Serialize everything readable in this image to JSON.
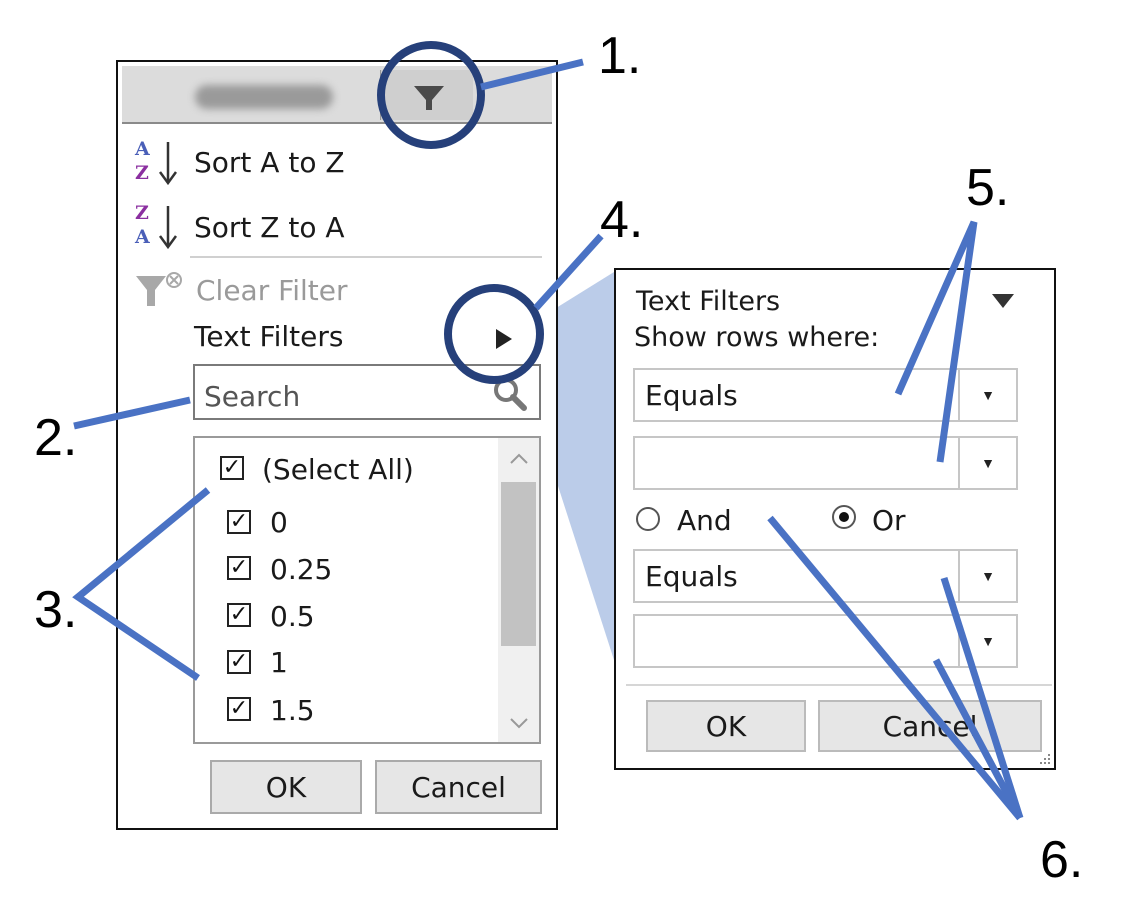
{
  "left_panel": {
    "menu": {
      "sort_az": "Sort A to Z",
      "sort_za": "Sort Z to A",
      "clear_filter": "Clear Filter",
      "text_filters": "Text Filters"
    },
    "sort_az_icon": {
      "top": "A",
      "bottom": "Z"
    },
    "sort_za_icon": {
      "top": "Z",
      "bottom": "A"
    },
    "search": {
      "placeholder": "Search"
    },
    "list": [
      {
        "label": "(Select All)",
        "checked": true
      },
      {
        "label": "0",
        "checked": true
      },
      {
        "label": "0.25",
        "checked": true
      },
      {
        "label": "0.5",
        "checked": true
      },
      {
        "label": "1",
        "checked": true
      },
      {
        "label": "1.5",
        "checked": true
      }
    ],
    "ok_label": "OK",
    "cancel_label": "Cancel"
  },
  "right_panel": {
    "title": "Text Filters",
    "subtitle": "Show rows where:",
    "condition1": {
      "operator": "Equals",
      "value": ""
    },
    "condition2": {
      "operator": "Equals",
      "value": ""
    },
    "and_label": "And",
    "or_label": "Or",
    "selected_logic": "Or",
    "ok_label": "OK",
    "cancel_label": "Cancel"
  },
  "callouts": [
    "1.",
    "2.",
    "3.",
    "4.",
    "5.",
    "6."
  ],
  "colors": {
    "annotation_blue": "#4a72c4",
    "circle_navy": "#26407a",
    "zoom_fill": "#b4c6e7"
  },
  "icons": {
    "check": "✓",
    "dropdown": "▼",
    "submenu": "▶"
  }
}
